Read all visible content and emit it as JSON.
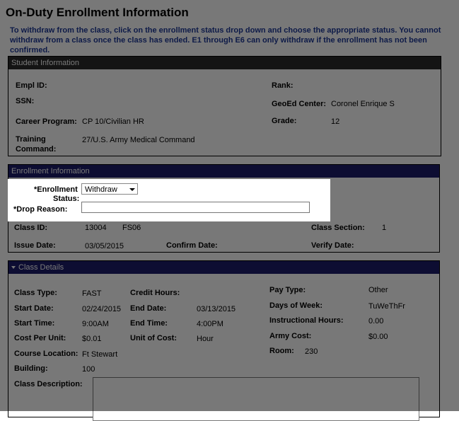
{
  "page": {
    "title": "On-Duty Enrollment Information",
    "instructions": "To withdraw from the class, click on the enrollment status drop down and choose the appropriate status.  You cannot withdraw from a class once the class has ended.  E1 through E6 can only withdraw if the enrollment has not been confirmed."
  },
  "student": {
    "header": "Student Information",
    "empl_id_label": "Empl ID:",
    "rank_label": "Rank:",
    "ssn_label": "SSN:",
    "geoed_label": "GeoEd Center:",
    "geoed_value": "Coronel Enrique S",
    "career_label": "Career Program:",
    "career_value": "CP 10/Civilian HR",
    "grade_label": "Grade:",
    "grade_value": "12",
    "training_label_1": "Training",
    "training_label_2": "Command:",
    "training_value": "27/U.S. Army Medical Command"
  },
  "enrollment": {
    "header": "Enrollment Information",
    "status_label_1": "*Enrollment",
    "status_label_2": "Status:",
    "status_value": "Withdraw",
    "drop_label": "*Drop Reason:",
    "drop_value": "",
    "class_id_label": "Class ID:",
    "class_id_value": "13004",
    "class_id_code": "FS06",
    "class_section_label": "Class Section:",
    "class_section_value": "1",
    "issue_date_label": "Issue Date:",
    "issue_date_value": "03/05/2015",
    "confirm_date_label": "Confirm Date:",
    "verify_date_label": "Verify Date:"
  },
  "class_details": {
    "header": "Class Details",
    "class_type_label": "Class Type:",
    "class_type_value": "FAST",
    "credit_hours_label": "Credit Hours:",
    "pay_type_label": "Pay Type:",
    "pay_type_value": "Other",
    "start_date_label": "Start Date:",
    "start_date_value": "02/24/2015",
    "end_date_label": "End Date:",
    "end_date_value": "03/13/2015",
    "days_label": "Days of Week:",
    "days_value": "TuWeThFr",
    "start_time_label": "Start Time:",
    "start_time_value": "9:00AM",
    "end_time_label": "End Time:",
    "end_time_value": "4:00PM",
    "instr_hours_label": "Instructional Hours:",
    "instr_hours_value": "0.00",
    "cost_label": "Cost Per Unit:",
    "cost_value": "$0.01",
    "unit_label": "Unit of Cost:",
    "unit_value": "Hour",
    "army_cost_label": "Army Cost:",
    "army_cost_value": "$0.00",
    "location_label": "Course Location:",
    "location_value": "Ft Stewart",
    "room_label": "Room:",
    "room_value": "230",
    "building_label": "Building:",
    "building_value": "100",
    "description_label": "Class Description:"
  }
}
